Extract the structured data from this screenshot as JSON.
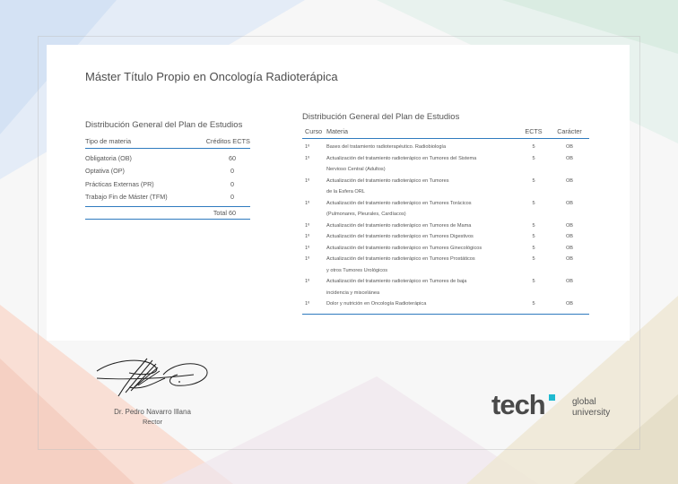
{
  "document": {
    "title": "Máster Título Propio en Oncología Radioterápica"
  },
  "summary_table": {
    "title": "Distribución General del Plan de Estudios",
    "header": {
      "type": "Tipo de materia",
      "credits": "Créditos ECTS"
    },
    "rows": [
      {
        "type": "Obligatoria (OB)",
        "credits": "60"
      },
      {
        "type": "Optativa (OP)",
        "credits": "0"
      },
      {
        "type": "Prácticas Externas (PR)",
        "credits": "0"
      },
      {
        "type": "Trabajo Fin de Máster (TFM)",
        "credits": "0"
      }
    ],
    "total": "Total 60"
  },
  "detail_table": {
    "title": "Distribución General del Plan de Estudios",
    "header": {
      "course": "Curso",
      "subject": "Materia",
      "ects": "ECTS",
      "type": "Carácter"
    },
    "rows": [
      {
        "course": "1º",
        "lines": [
          "Bases del tratamiento radioterapéutico. Radiobiología"
        ],
        "ects": "5",
        "type": "OB"
      },
      {
        "course": "1º",
        "lines": [
          "Actualización del tratamiento radioterápico en Tumores del Sistema",
          "Nervioso Central (Adultos)"
        ],
        "ects": "5",
        "type": "OB"
      },
      {
        "course": "1º",
        "lines": [
          "Actualización del tratamiento radioterápico en Tumores",
          "de la Esfera ORL"
        ],
        "ects": "5",
        "type": "OB"
      },
      {
        "course": "1º",
        "lines": [
          "Actualización del tratamiento radioterápico en Tumores Torácicos",
          "(Pulmonares, Pleurales, Cardíacos)"
        ],
        "ects": "5",
        "type": "OB"
      },
      {
        "course": "1º",
        "lines": [
          "Actualización del tratamiento radioterápico en Tumores de Mama"
        ],
        "ects": "5",
        "type": "OB"
      },
      {
        "course": "1º",
        "lines": [
          "Actualización del tratamiento radioterápico en Tumores Digestivos"
        ],
        "ects": "5",
        "type": "OB"
      },
      {
        "course": "1º",
        "lines": [
          "Actualización del tratamiento radioterápico en Tumores Ginecológicos"
        ],
        "ects": "5",
        "type": "OB"
      },
      {
        "course": "1º",
        "lines": [
          "Actualización del tratamiento radioterápico en Tumores Prostáticos",
          "y otros Tumores Urológicos"
        ],
        "ects": "5",
        "type": "OB"
      },
      {
        "course": "1º",
        "lines": [
          "Actualización del tratamiento radioterápico en Tumores de baja",
          "incidencia y miscelánea"
        ],
        "ects": "5",
        "type": "OB"
      },
      {
        "course": "1º",
        "lines": [
          "Dolor y nutrición en Oncología Radioterápica"
        ],
        "ects": "5",
        "type": "OB"
      }
    ]
  },
  "signature": {
    "name": "Dr. Pedro Navarro Illana",
    "role": "Rector"
  },
  "logo": {
    "word": "tech",
    "line1": "global",
    "line2": "university",
    "accent_color": "#1fb9d0"
  }
}
